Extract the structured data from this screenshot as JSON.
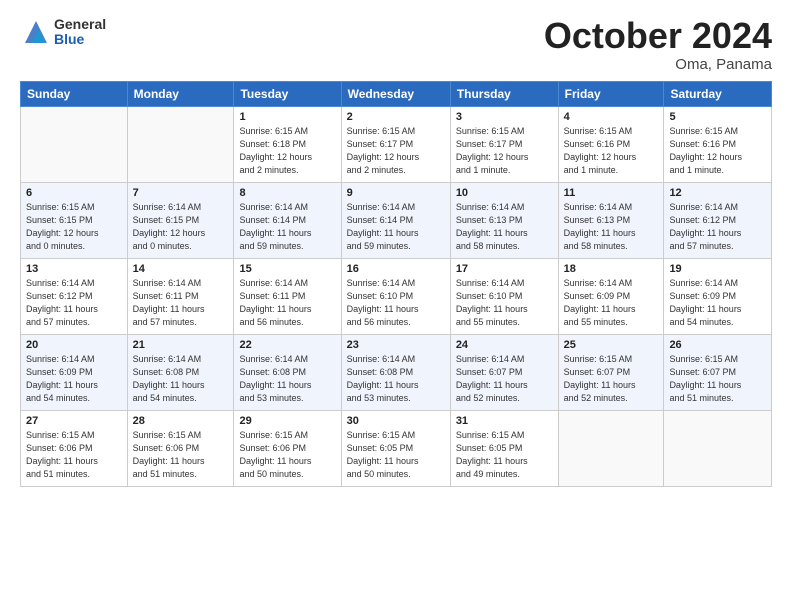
{
  "header": {
    "logo_general": "General",
    "logo_blue": "Blue",
    "month_title": "October 2024",
    "location": "Oma, Panama"
  },
  "weekdays": [
    "Sunday",
    "Monday",
    "Tuesday",
    "Wednesday",
    "Thursday",
    "Friday",
    "Saturday"
  ],
  "weeks": [
    [
      {
        "day": "",
        "info": ""
      },
      {
        "day": "",
        "info": ""
      },
      {
        "day": "1",
        "info": "Sunrise: 6:15 AM\nSunset: 6:18 PM\nDaylight: 12 hours\nand 2 minutes."
      },
      {
        "day": "2",
        "info": "Sunrise: 6:15 AM\nSunset: 6:17 PM\nDaylight: 12 hours\nand 2 minutes."
      },
      {
        "day": "3",
        "info": "Sunrise: 6:15 AM\nSunset: 6:17 PM\nDaylight: 12 hours\nand 1 minute."
      },
      {
        "day": "4",
        "info": "Sunrise: 6:15 AM\nSunset: 6:16 PM\nDaylight: 12 hours\nand 1 minute."
      },
      {
        "day": "5",
        "info": "Sunrise: 6:15 AM\nSunset: 6:16 PM\nDaylight: 12 hours\nand 1 minute."
      }
    ],
    [
      {
        "day": "6",
        "info": "Sunrise: 6:15 AM\nSunset: 6:15 PM\nDaylight: 12 hours\nand 0 minutes."
      },
      {
        "day": "7",
        "info": "Sunrise: 6:14 AM\nSunset: 6:15 PM\nDaylight: 12 hours\nand 0 minutes."
      },
      {
        "day": "8",
        "info": "Sunrise: 6:14 AM\nSunset: 6:14 PM\nDaylight: 11 hours\nand 59 minutes."
      },
      {
        "day": "9",
        "info": "Sunrise: 6:14 AM\nSunset: 6:14 PM\nDaylight: 11 hours\nand 59 minutes."
      },
      {
        "day": "10",
        "info": "Sunrise: 6:14 AM\nSunset: 6:13 PM\nDaylight: 11 hours\nand 58 minutes."
      },
      {
        "day": "11",
        "info": "Sunrise: 6:14 AM\nSunset: 6:13 PM\nDaylight: 11 hours\nand 58 minutes."
      },
      {
        "day": "12",
        "info": "Sunrise: 6:14 AM\nSunset: 6:12 PM\nDaylight: 11 hours\nand 57 minutes."
      }
    ],
    [
      {
        "day": "13",
        "info": "Sunrise: 6:14 AM\nSunset: 6:12 PM\nDaylight: 11 hours\nand 57 minutes."
      },
      {
        "day": "14",
        "info": "Sunrise: 6:14 AM\nSunset: 6:11 PM\nDaylight: 11 hours\nand 57 minutes."
      },
      {
        "day": "15",
        "info": "Sunrise: 6:14 AM\nSunset: 6:11 PM\nDaylight: 11 hours\nand 56 minutes."
      },
      {
        "day": "16",
        "info": "Sunrise: 6:14 AM\nSunset: 6:10 PM\nDaylight: 11 hours\nand 56 minutes."
      },
      {
        "day": "17",
        "info": "Sunrise: 6:14 AM\nSunset: 6:10 PM\nDaylight: 11 hours\nand 55 minutes."
      },
      {
        "day": "18",
        "info": "Sunrise: 6:14 AM\nSunset: 6:09 PM\nDaylight: 11 hours\nand 55 minutes."
      },
      {
        "day": "19",
        "info": "Sunrise: 6:14 AM\nSunset: 6:09 PM\nDaylight: 11 hours\nand 54 minutes."
      }
    ],
    [
      {
        "day": "20",
        "info": "Sunrise: 6:14 AM\nSunset: 6:09 PM\nDaylight: 11 hours\nand 54 minutes."
      },
      {
        "day": "21",
        "info": "Sunrise: 6:14 AM\nSunset: 6:08 PM\nDaylight: 11 hours\nand 54 minutes."
      },
      {
        "day": "22",
        "info": "Sunrise: 6:14 AM\nSunset: 6:08 PM\nDaylight: 11 hours\nand 53 minutes."
      },
      {
        "day": "23",
        "info": "Sunrise: 6:14 AM\nSunset: 6:08 PM\nDaylight: 11 hours\nand 53 minutes."
      },
      {
        "day": "24",
        "info": "Sunrise: 6:14 AM\nSunset: 6:07 PM\nDaylight: 11 hours\nand 52 minutes."
      },
      {
        "day": "25",
        "info": "Sunrise: 6:15 AM\nSunset: 6:07 PM\nDaylight: 11 hours\nand 52 minutes."
      },
      {
        "day": "26",
        "info": "Sunrise: 6:15 AM\nSunset: 6:07 PM\nDaylight: 11 hours\nand 51 minutes."
      }
    ],
    [
      {
        "day": "27",
        "info": "Sunrise: 6:15 AM\nSunset: 6:06 PM\nDaylight: 11 hours\nand 51 minutes."
      },
      {
        "day": "28",
        "info": "Sunrise: 6:15 AM\nSunset: 6:06 PM\nDaylight: 11 hours\nand 51 minutes."
      },
      {
        "day": "29",
        "info": "Sunrise: 6:15 AM\nSunset: 6:06 PM\nDaylight: 11 hours\nand 50 minutes."
      },
      {
        "day": "30",
        "info": "Sunrise: 6:15 AM\nSunset: 6:05 PM\nDaylight: 11 hours\nand 50 minutes."
      },
      {
        "day": "31",
        "info": "Sunrise: 6:15 AM\nSunset: 6:05 PM\nDaylight: 11 hours\nand 49 minutes."
      },
      {
        "day": "",
        "info": ""
      },
      {
        "day": "",
        "info": ""
      }
    ]
  ]
}
